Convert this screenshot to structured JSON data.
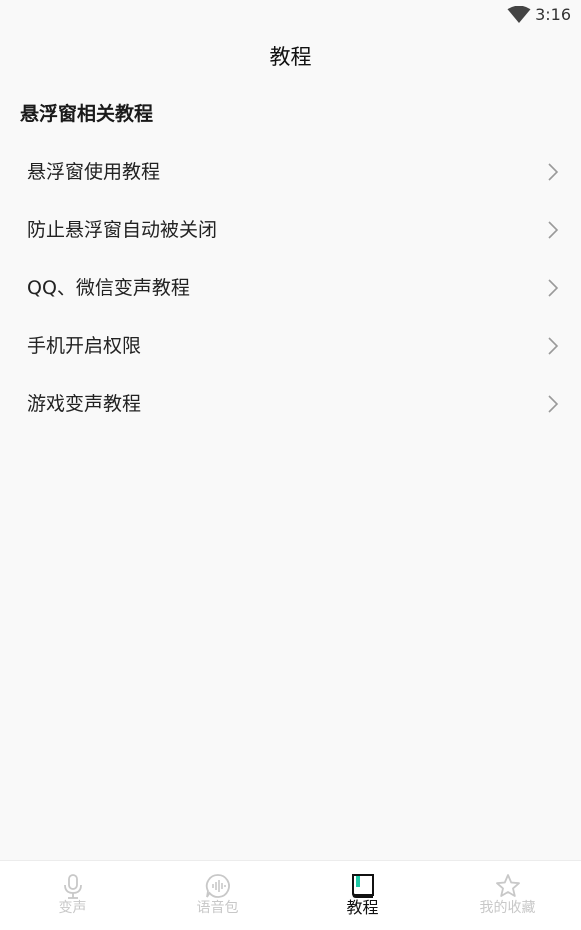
{
  "status_bar": {
    "time": "3:16"
  },
  "header": {
    "title": "教程"
  },
  "section": {
    "title": "悬浮窗相关教程",
    "items": [
      {
        "label": "悬浮窗使用教程"
      },
      {
        "label": "防止悬浮窗自动被关闭"
      },
      {
        "label": "QQ、微信变声教程"
      },
      {
        "label": "手机开启权限"
      },
      {
        "label": "游戏变声教程"
      }
    ]
  },
  "tab_bar": {
    "active_index": 2,
    "tabs": [
      {
        "label": "变声",
        "icon": "microphone-icon"
      },
      {
        "label": "语音包",
        "icon": "voice-pack-icon"
      },
      {
        "label": "教程",
        "icon": "book-icon"
      },
      {
        "label": "我的收藏",
        "icon": "star-icon"
      }
    ]
  },
  "colors": {
    "background": "#f9f9f9",
    "active_tab": "#111111",
    "inactive_tab": "#c8c8c8",
    "accent": "#1fc9a6"
  }
}
